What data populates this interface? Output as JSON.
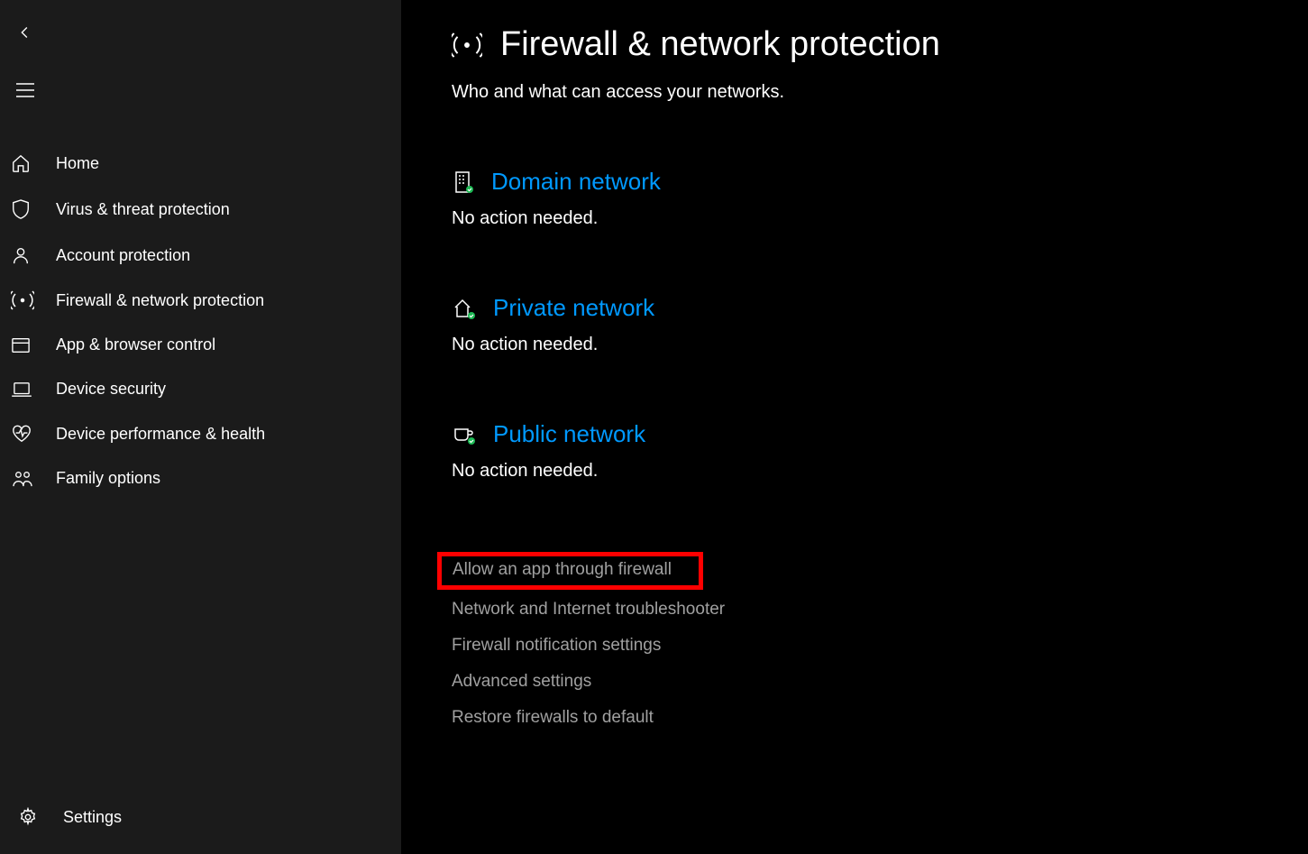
{
  "sidebar": {
    "items": [
      {
        "label": "Home",
        "icon": "home-icon"
      },
      {
        "label": "Virus & threat protection",
        "icon": "shield-icon"
      },
      {
        "label": "Account protection",
        "icon": "person-icon"
      },
      {
        "label": "Firewall & network protection",
        "icon": "antenna-icon"
      },
      {
        "label": "App & browser control",
        "icon": "browser-icon"
      },
      {
        "label": "Device security",
        "icon": "device-icon"
      },
      {
        "label": "Device performance & health",
        "icon": "heart-icon"
      },
      {
        "label": "Family options",
        "icon": "family-icon"
      }
    ],
    "settings_label": "Settings"
  },
  "main": {
    "title": "Firewall & network protection",
    "subtitle": "Who and what can access your networks.",
    "networks": [
      {
        "name": "Domain network",
        "status": "No action needed.",
        "icon": "building-icon"
      },
      {
        "name": "Private network",
        "status": "No action needed.",
        "icon": "house-icon"
      },
      {
        "name": "Public network",
        "status": "No action needed.",
        "icon": "coffee-icon"
      }
    ],
    "actions": [
      {
        "label": "Allow an app through firewall",
        "highlight": true
      },
      {
        "label": "Network and Internet troubleshooter"
      },
      {
        "label": "Firewall notification settings"
      },
      {
        "label": "Advanced settings"
      },
      {
        "label": "Restore firewalls to default"
      }
    ]
  }
}
